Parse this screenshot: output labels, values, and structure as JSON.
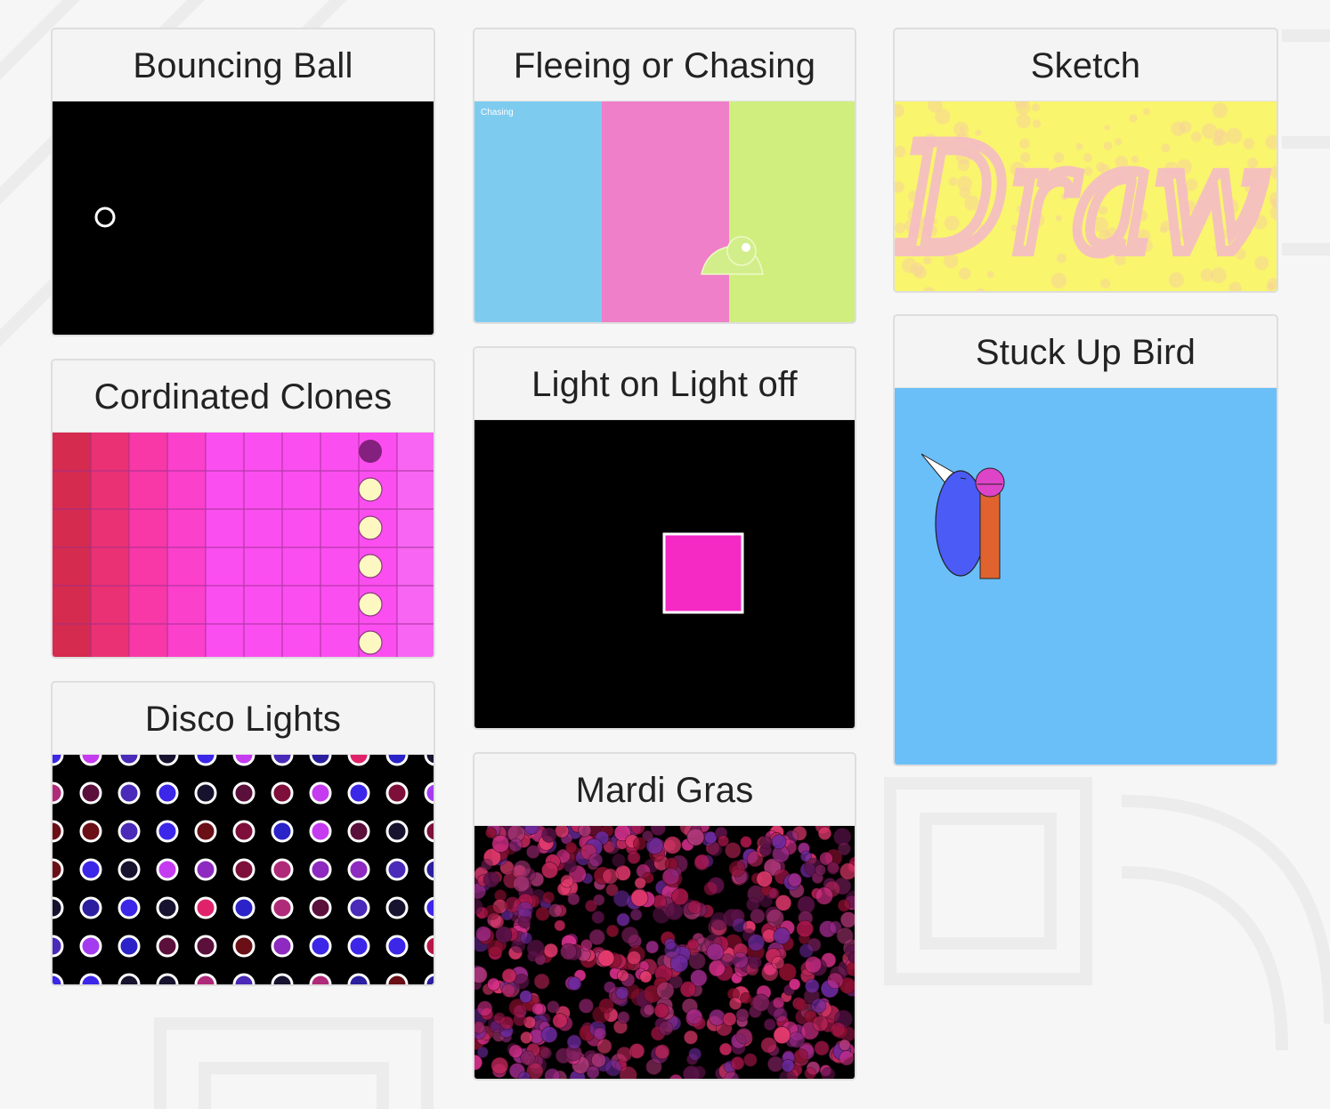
{
  "projects": [
    {
      "title": "Bouncing Ball"
    },
    {
      "title": "Cordinated Clones"
    },
    {
      "title": "Disco Lights"
    },
    {
      "title": "Fleeing or Chasing",
      "thumb_text": "Chasing"
    },
    {
      "title": "Light on Light off"
    },
    {
      "title": "Mardi Gras"
    },
    {
      "title": "Sketch",
      "thumb_text": "Draw"
    },
    {
      "title": "Stuck Up Bird"
    }
  ],
  "colors": {
    "page_background": "#f6f6f6",
    "card_background": "#f4f4f4",
    "fleeing_blue": "#7ecbf0",
    "fleeing_pink": "#ee7fc8",
    "fleeing_green": "#d0ee7e",
    "light_square": "#f52ac5",
    "sketch_yellow": "#f9f56d",
    "sketch_pink": "#f5bcc6",
    "bird_sky": "#6bbff8",
    "bird_body": "#4b5bf6",
    "bird_head": "#dd44c8",
    "bird_perch": "#e0632f"
  },
  "icons": [
    "ball-icon",
    "chameleon-icon",
    "bird-icon"
  ]
}
